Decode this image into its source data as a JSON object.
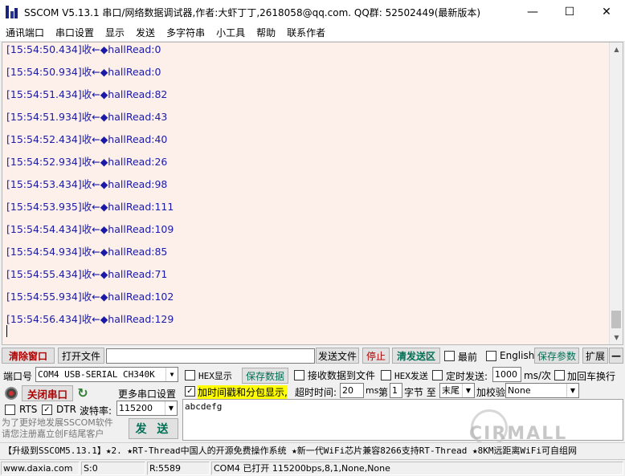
{
  "window": {
    "title": "SSCOM V5.13.1 串口/网络数据调试器,作者:大虾丁丁,2618058@qq.com. QQ群: 52502449(最新版本)",
    "minimize": "—",
    "maximize": "☐",
    "close": "✕"
  },
  "menu": [
    "通讯端口",
    "串口设置",
    "显示",
    "发送",
    "多字符串",
    "小工具",
    "帮助",
    "联系作者"
  ],
  "receive": {
    "lines": [
      "[15:54:50.434]收←◆hallRead:0",
      "[15:54:50.934]收←◆hallRead:0",
      "[15:54:51.434]收←◆hallRead:82",
      "[15:54:51.934]收←◆hallRead:43",
      "[15:54:52.434]收←◆hallRead:40",
      "[15:54:52.934]收←◆hallRead:26",
      "[15:54:53.434]收←◆hallRead:98",
      "[15:54:53.935]收←◆hallRead:111",
      "[15:54:54.434]收←◆hallRead:109",
      "[15:54:54.934]收←◆hallRead:85",
      "[15:54:55.434]收←◆hallRead:71",
      "[15:54:55.934]收←◆hallRead:102",
      "[15:54:56.434]收←◆hallRead:129"
    ]
  },
  "toolbar1": {
    "clear_window": "清除窗口",
    "open_file": "打开文件",
    "send_file": "发送文件",
    "stop": "停止",
    "clear_send": "清发送区",
    "topmost": "最前",
    "english": "English",
    "save_params": "保存参数",
    "expand": "扩展",
    "collapse": "—"
  },
  "row2": {
    "port_label": "端口号",
    "port_value": "COM4 USB-SERIAL CH340K",
    "hex_display": "HEX显示",
    "save_data": "保存数据",
    "recv_to_file": "接收数据到文件",
    "hex_send": "HEX发送",
    "timed_send": "定时发送:",
    "interval": "1000",
    "interval_unit": "ms/次",
    "add_newline": "加回车换行",
    "hex_display_checked": false,
    "recv_to_file_checked": false,
    "hex_send_checked": false,
    "timed_send_checked": false,
    "add_newline_checked": false
  },
  "row3": {
    "close_port": "关闭串口",
    "more_settings": "更多串口设置",
    "timestamp_label": "加时间戳和分包显示,",
    "timestamp_checked": true,
    "timeout_label": "超时时间:",
    "timeout_value": "20",
    "timeout_unit": "ms",
    "nth_label": "第",
    "nth_value": "1",
    "byte_label": "字节 至",
    "byte_end": "末尾",
    "checksum_label": "加校验",
    "checksum_value": "None"
  },
  "row4": {
    "rts": "RTS",
    "dtr": "DTR",
    "rts_checked": false,
    "dtr_checked": true,
    "baud_label": "波特率:",
    "baud_value": "115200"
  },
  "send": {
    "text": "abcdefg",
    "button": "发 送",
    "hint_line1": "为了更好地发展SSCOM软件",
    "hint_line2": "请您注册嘉立创F结尾客户"
  },
  "ticker": "【升级到SSCOM5.13.1】★2. ★RT-Thread中国人的开源免费操作系统 ★新一代WiFi芯片兼容8266支持RT-Thread ★8KM远距离WiFi可自组网",
  "status": {
    "website": "www.daxia.com",
    "sent": "S:0",
    "received": "R:5589",
    "port_status": "COM4 已打开  115200bps,8,1,None,None"
  },
  "watermark": "CIRMALL",
  "colors": {
    "receive_bg": "#fdf0ea",
    "receive_text": "#1a1aa6",
    "accent_green": "#006f55",
    "accent_red": "#b00000",
    "highlight": "#ffff00"
  }
}
